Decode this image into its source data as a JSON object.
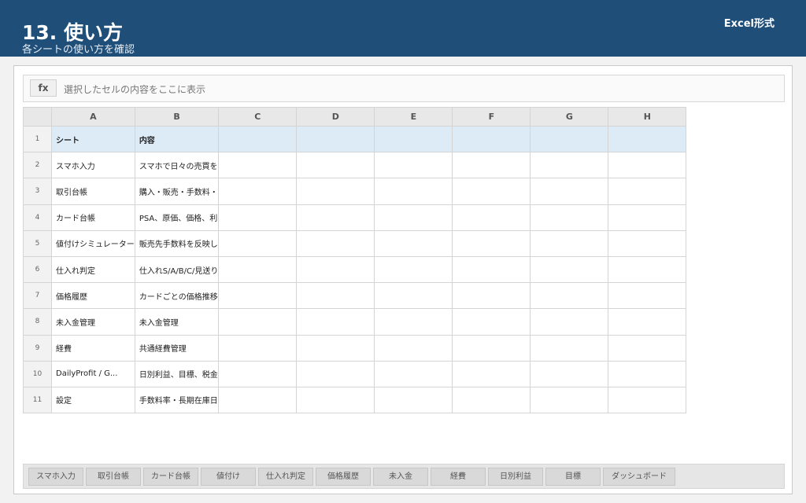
{
  "header": {
    "title": "13. 使い方",
    "subtitle": "各シートの使い方を確認",
    "badge": "Excel形式"
  },
  "formula_bar": {
    "fx_label": "fx",
    "text": "選択したセルの内容をここに表示"
  },
  "columns": [
    "A",
    "B",
    "C",
    "D",
    "E",
    "F",
    "G",
    "H"
  ],
  "rows": [
    {
      "num": "1",
      "a": "シート",
      "b": "内容"
    },
    {
      "num": "2",
      "a": "スマホ入力",
      "b": "スマホで日々の売買を"
    },
    {
      "num": "3",
      "a": "取引台帳",
      "b": "購入・販売・手数料・"
    },
    {
      "num": "4",
      "a": "カード台帳",
      "b": "PSA、原価、価格、利"
    },
    {
      "num": "5",
      "a": "値付けシミュレーター",
      "b": "販売先手数料を反映し"
    },
    {
      "num": "6",
      "a": "仕入れ判定",
      "b": "仕入れS/A/B/C/見送り"
    },
    {
      "num": "7",
      "a": "価格履歴",
      "b": "カードごとの価格推移"
    },
    {
      "num": "8",
      "a": "未入金管理",
      "b": "未入金管理"
    },
    {
      "num": "9",
      "a": "経費",
      "b": "共通経費管理"
    },
    {
      "num": "10",
      "a": "DailyProfit / G...",
      "b": "日別利益、目標、税金"
    },
    {
      "num": "11",
      "a": "設定",
      "b": "手数料率・長期在庫日"
    }
  ],
  "tabs": [
    "スマホ入力",
    "取引台帳",
    "カード台帳",
    "値付け",
    "仕入れ判定",
    "価格履歴",
    "未入金",
    "経費",
    "日別利益",
    "目標",
    "ダッシュボード"
  ],
  "colors": {
    "header_bg": "#1f4e79",
    "header_row_bg": "#ddebf7"
  }
}
